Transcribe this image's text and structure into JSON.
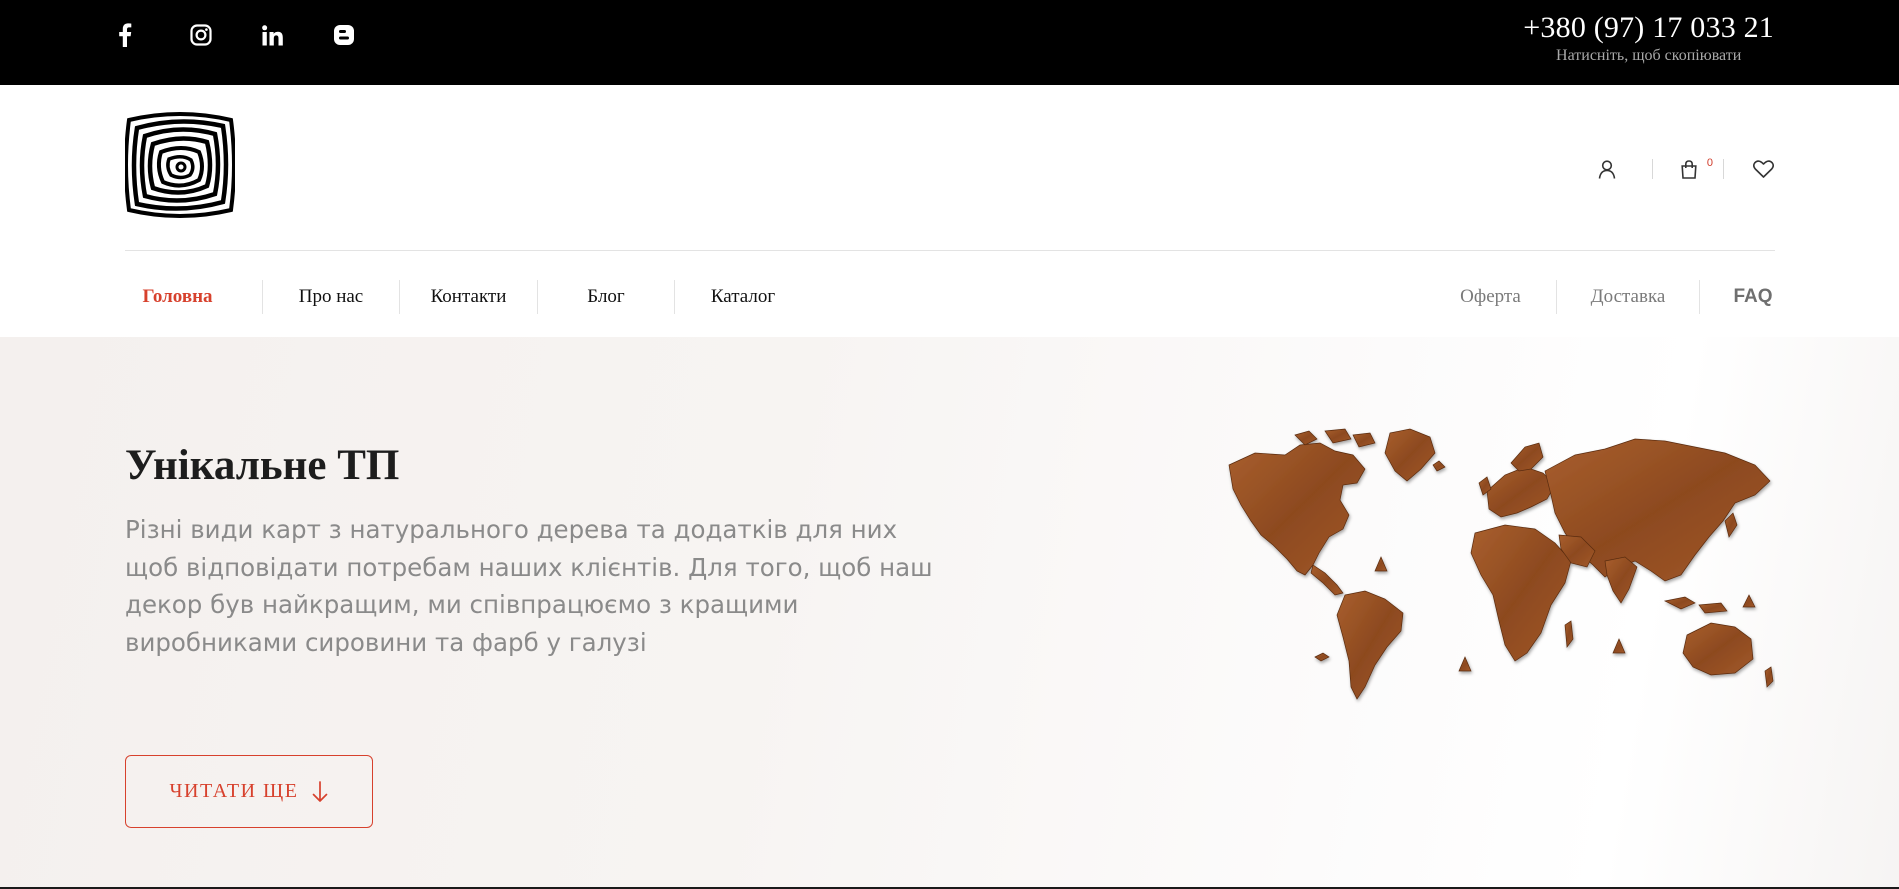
{
  "topbar": {
    "social_icons": [
      "facebook-icon",
      "instagram-icon",
      "linkedin-icon",
      "blogger-icon"
    ],
    "phone": "+380 (97) 17 033 21",
    "phone_hint": "Натисніть, щоб скопіювати"
  },
  "header": {
    "logo": "tree-rings-logo",
    "icons": [
      "user-icon",
      "cart-icon",
      "heart-icon"
    ],
    "cart_count": "0"
  },
  "nav": {
    "left": [
      {
        "label": "Головна",
        "active": true
      },
      {
        "label": "Про нас",
        "active": false
      },
      {
        "label": "Контакти",
        "active": false
      },
      {
        "label": "Блог",
        "active": false
      },
      {
        "label": "Каталог",
        "active": false
      }
    ],
    "right": [
      {
        "label": "Оферта"
      },
      {
        "label": "Доставка"
      },
      {
        "label": "FAQ"
      }
    ]
  },
  "hero": {
    "title": "Унікальне ТП",
    "text": "Різні види карт з натурального дерева та додатків для них щоб відповідати потребам наших клієнтів. Для того, щоб наш декор був найкращим, ми співпрацюємо з кращими виробниками сировини та фарб у галузі",
    "button": "ЧИТАТИ ЩЕ",
    "image": "wooden-world-map-image"
  },
  "colors": {
    "accent": "#d7412d",
    "topbar_bg": "#000000",
    "map_wood": "#9a5428"
  }
}
